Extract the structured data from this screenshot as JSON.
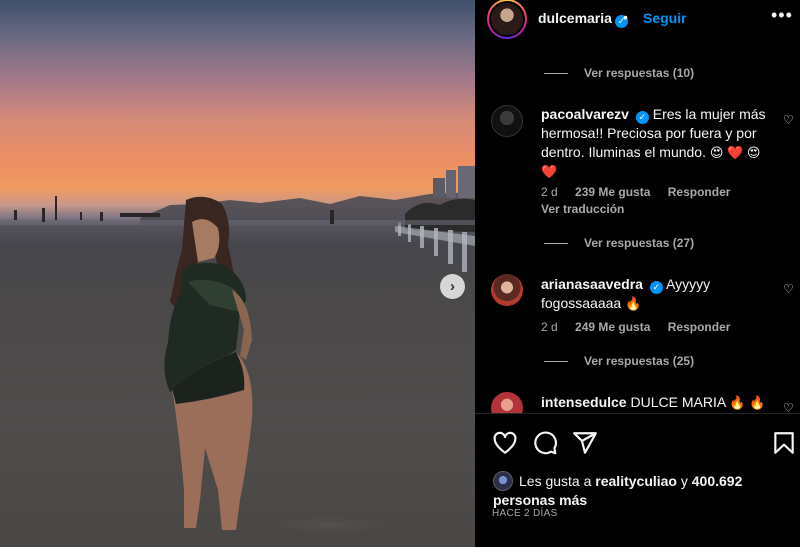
{
  "post": {
    "username": "dulcemaria",
    "verified_mark": "✓",
    "separator": "•",
    "follow_label": "Seguir",
    "more_label": "•••",
    "next_arrow": "›"
  },
  "comments": [
    {
      "type": "replies",
      "label": "Ver respuestas (10)"
    },
    {
      "type": "comment",
      "username": "pacoalvarezv",
      "text": "Eres la mujer más hermosa!! Preciosa por fuera y por dentro. Iluminas el mundo.",
      "emojis": "😍 ❤️ 😍 ❤️",
      "time": "2 d",
      "likes": "239 Me gusta",
      "reply": "Responder",
      "translation": "Ver traducción"
    },
    {
      "type": "replies",
      "label": "Ver respuestas (27)"
    },
    {
      "type": "comment",
      "username": "arianasaavedra",
      "text": "Ayyyyy fogossaaaaa",
      "emojis": "🔥",
      "time": "2 d",
      "likes": "249 Me gusta",
      "reply": "Responder"
    },
    {
      "type": "replies",
      "label": "Ver respuestas (25)"
    },
    {
      "type": "comment",
      "username": "intensedulce",
      "text": "DULCE MARIA",
      "emojis": "🔥 🔥"
    }
  ],
  "likes": {
    "prefix": "Les gusta a",
    "user": "realityculiao",
    "joiner": "y",
    "count": "400.692",
    "suffix": "personas más"
  },
  "time_ago": "HACE 2 DÍAS",
  "icons": {
    "like": "heart-icon",
    "comment": "comment-icon",
    "share": "share-icon",
    "save": "bookmark-icon",
    "more": "more-options-icon",
    "next": "chevron-right-icon"
  },
  "colors": {
    "background": "#000000",
    "accent": "#0095f6",
    "secondary_text": "#a8a8a8",
    "primary_text": "#f5f5f5"
  }
}
